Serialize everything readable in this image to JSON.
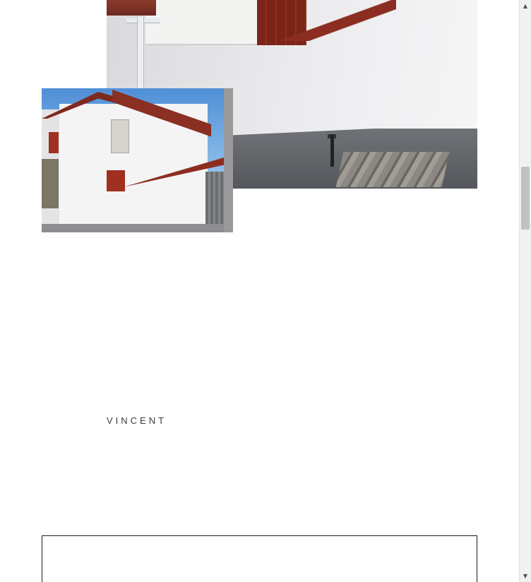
{
  "gallery": {
    "large_photo": {
      "subject": "white-wall-with-tap-photo"
    },
    "small_photo": {
      "subject": "white-house-red-roof-photo"
    }
  },
  "testimonial": {
    "author": "VINCENT"
  },
  "scrollbar": {
    "up_icon": "▲",
    "down_icon": "▼"
  }
}
